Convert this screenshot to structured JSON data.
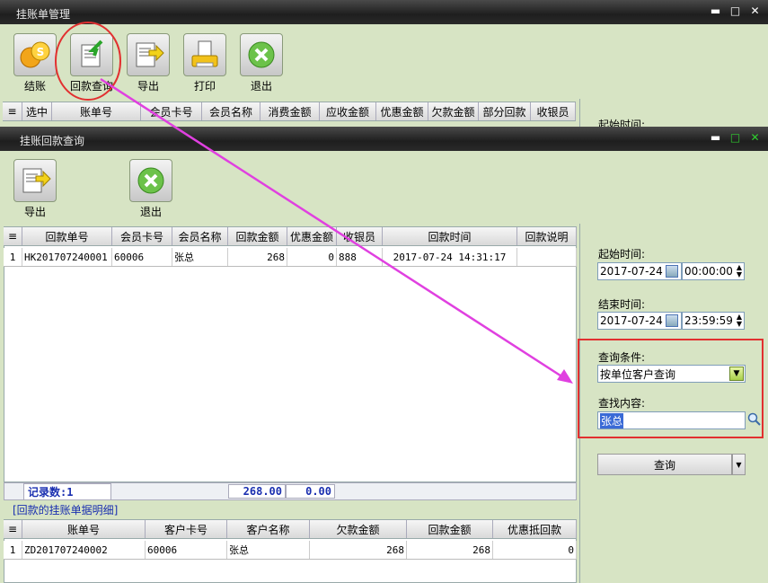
{
  "outer_window": {
    "title": "挂账单管理",
    "toolbar": [
      {
        "label": "结账",
        "icon": "coins-icon"
      },
      {
        "label": "回款查询",
        "icon": "return-query-icon"
      },
      {
        "label": "导出",
        "icon": "export-icon"
      },
      {
        "label": "打印",
        "icon": "print-icon"
      },
      {
        "label": "退出",
        "icon": "exit-icon"
      }
    ],
    "columns": [
      "选中",
      "账单号",
      "会员卡号",
      "会员名称",
      "消费金额",
      "应收金额",
      "优惠金额",
      "欠款金额",
      "部分回款",
      "收银员"
    ],
    "right_panel_partial_label": "起始时间:"
  },
  "inner_window": {
    "title": "挂账回款查询",
    "toolbar": [
      {
        "label": "导出",
        "icon": "export-icon"
      },
      {
        "label": "退出",
        "icon": "exit-icon"
      }
    ],
    "main_table": {
      "columns": [
        "回款单号",
        "会员卡号",
        "会员名称",
        "回款金额",
        "优惠金额",
        "收银员",
        "回款时间",
        "回款说明"
      ],
      "rows": [
        {
          "index": "1",
          "id": "HK201707240001",
          "card": "60006",
          "name": "张总",
          "amount": "268",
          "discount": "0",
          "cashier": "888",
          "time": "2017-07-24 14:31:17",
          "note": ""
        }
      ],
      "summary": {
        "record_label": "记录数:1",
        "amount_total": "268.00",
        "discount_total": "0.00"
      }
    },
    "detail_title": "[回款的挂账单据明细]",
    "detail_table": {
      "columns": [
        "账单号",
        "客户卡号",
        "客户名称",
        "欠款金额",
        "回款金额",
        "优惠抵回款"
      ],
      "rows": [
        {
          "index": "1",
          "id": "ZD201707240002",
          "card": "60006",
          "name": "张总",
          "debt": "268",
          "returned": "268",
          "offset": "0"
        }
      ]
    },
    "filters": {
      "start_label": "起始时间:",
      "start_date": "2017-07-24",
      "start_time": "00:00:00",
      "end_label": "结束时间:",
      "end_date": "2017-07-24",
      "end_time": "23:59:59",
      "condition_label": "查询条件:",
      "condition_value": "按单位客户查询",
      "content_label": "查找内容:",
      "content_value": "张总",
      "query_button": "查询"
    }
  },
  "colors": {
    "highlight_red": "#e23030",
    "arrow_magenta": "#e040e0",
    "summary_blue": "#1a2fb0"
  }
}
